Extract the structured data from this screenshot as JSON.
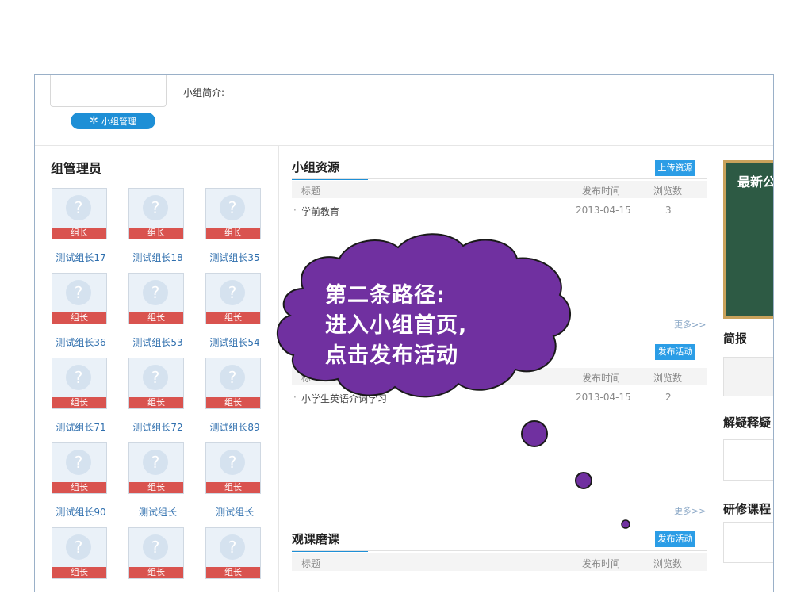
{
  "group": {
    "intro_label": "小组简介:",
    "manage_button": "小组管理",
    "manage_icon": "gear-icon"
  },
  "admins": {
    "title": "组管理员",
    "role_badge": "组长",
    "placeholder_glyph": "?",
    "members": [
      "测试组长17",
      "测试组长18",
      "测试组长35",
      "测试组长36",
      "测试组长53",
      "测试组长54",
      "测试组长71",
      "测试组长72",
      "测试组长89",
      "测试组长90",
      "测试组长",
      "测试组长",
      "",
      "",
      ""
    ]
  },
  "resources": {
    "title": "小组资源",
    "upload_button": "上传资源",
    "columns": {
      "title": "标题",
      "date": "发布时间",
      "views": "浏览数"
    },
    "rows": [
      {
        "title": "学前教育",
        "date": "2013-04-15",
        "views": "3"
      }
    ],
    "more": "更多>>"
  },
  "activities": {
    "publish_button": "发布活动",
    "columns": {
      "title": "标",
      "date": "发布时间",
      "views": "浏览数"
    },
    "rows": [
      {
        "title": "小学生英语介词学习",
        "date": "2013-04-15",
        "views": "2"
      }
    ],
    "more": "更多>>"
  },
  "lessons": {
    "title": "观课磨课",
    "publish_button": "发布活动",
    "columns": {
      "title": "标题",
      "date": "发布时间",
      "views": "浏览数"
    }
  },
  "right": {
    "notice_title": "最新公",
    "brief_title": "简报",
    "qa_title": "解疑释疑",
    "course_title": "研修课程"
  },
  "callout": {
    "line1": "第二条路径:",
    "line2": "进入小组首页,",
    "line3": "点击发布活动"
  },
  "colors": {
    "accent": "#1e8fd6",
    "role_badge": "#d9534f",
    "callout_fill": "#7030a0",
    "board": "#2d5a44"
  }
}
